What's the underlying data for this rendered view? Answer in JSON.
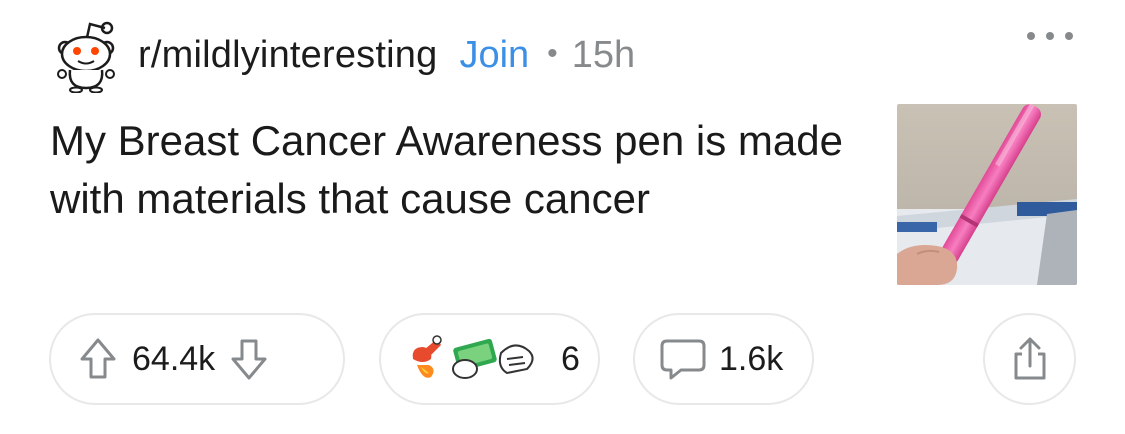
{
  "post": {
    "subreddit": "r/mildlyinteresting",
    "join_label": "Join",
    "separator": "•",
    "time_ago": "15h",
    "title": "My Breast Cancer Awareness pen is made with materials that cause cancer"
  },
  "actions": {
    "vote_count": "64.4k",
    "award_count": "6",
    "comment_count": "1.6k"
  },
  "icons": {
    "avatar": "reddit-snoo-icon",
    "more": "more-options-icon",
    "upvote": "upvote-arrow-icon",
    "downvote": "downvote-arrow-icon",
    "awards": "award-icons",
    "comment": "comment-bubble-icon",
    "share": "share-icon"
  },
  "colors": {
    "join": "#3b8fe5",
    "meta": "#878a8c",
    "pill_border": "#e8e8e8",
    "pen": "#f05aa8"
  }
}
